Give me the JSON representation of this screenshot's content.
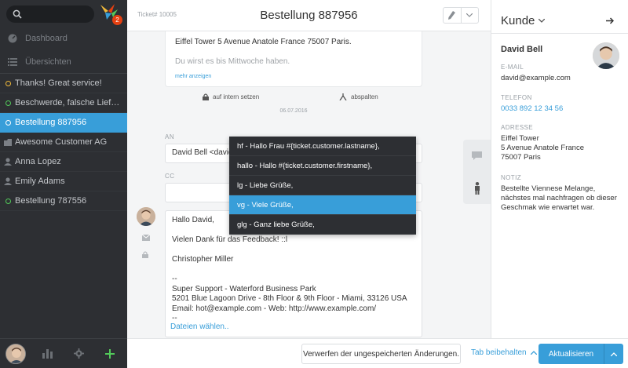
{
  "sidebar": {
    "search": {
      "placeholder": ""
    },
    "logo": {
      "badge": "2"
    },
    "main_nav": [
      {
        "label": "Dashboard",
        "icon": "dashboard-icon"
      },
      {
        "label": "Übersichten",
        "icon": "list-icon"
      }
    ],
    "items": [
      {
        "label": "Thanks! Great service!",
        "icon": "ticket-ring-icon",
        "color": "#f0b93a"
      },
      {
        "label": "Beschwerde, falsche Lieferung ...",
        "icon": "ticket-ring-icon",
        "color": "#52c95a"
      },
      {
        "label": "Bestellung 887956",
        "icon": "ticket-ring-icon",
        "color": "#ffffff",
        "active": true
      },
      {
        "label": "Awesome Customer AG",
        "icon": "organization-icon"
      },
      {
        "label": "Anna Lopez",
        "icon": "user-icon"
      },
      {
        "label": "Emily Adams",
        "icon": "user-icon"
      },
      {
        "label": "Bestellung 787556",
        "icon": "ticket-ring-icon",
        "color": "#52c95a"
      }
    ],
    "bottom": [
      "avatar",
      "stats-icon",
      "gear-icon",
      "plus-icon"
    ]
  },
  "header": {
    "ticket_number": "Ticket# 10005",
    "title": "Bestellung 887956"
  },
  "message": {
    "line1": "Eiffel Tower 5 Avenue Anatole France 75007 Paris.",
    "line2": "Du wirst es bis Mittwoche haben.",
    "more": "mehr anzeigen",
    "action_internal": "auf intern setzen",
    "action_split": "abspalten",
    "date": "06.07.2016"
  },
  "compose": {
    "to_label": "AN",
    "to_value": "David Bell <david@",
    "cc_label": "CC",
    "cc_value": "",
    "body_lines": [
      "Hallo David,",
      "",
      "Vielen Dank für das Feedback! ::l",
      "",
      "Christopher Miller",
      "",
      "--",
      "Super Support - Waterford Business Park",
      "5201 Blue Lagoon Drive - 8th Floor & 9th Floor - Miami, 33126 USA",
      "Email: hot@example.com - Web: http://www.example.com/",
      "--"
    ],
    "attach": "Dateien wählen.."
  },
  "dropdown": [
    {
      "label": "hf - Hallo Frau #{ticket.customer.lastname},"
    },
    {
      "label": "hallo - Hallo #{ticket.customer.firstname},"
    },
    {
      "label": "lg - Liebe Grüße,"
    },
    {
      "label": "vg - Viele Grüße,",
      "active": true
    },
    {
      "label": "glg - Ganz liebe Grüße,"
    }
  ],
  "bottom_bar": {
    "discard": "Verwerfen der ungespeicherten Änderungen.",
    "keep_tab": "Tab beibehalten",
    "update": "Aktualisieren"
  },
  "customer": {
    "title": "Kunde",
    "name": "David Bell",
    "email_label": "E-MAIL",
    "email": "david@example.com",
    "phone_label": "TELEFON",
    "phone": "0033 892 12 34 56",
    "address_label": "ADRESSE",
    "address_lines": [
      "Eiffel Tower",
      "5 Avenue Anatole France",
      "75007 Paris"
    ],
    "note_label": "NOTIZ",
    "note": "Bestellte Viennese Melange, nächstes mal nachfragen ob dieser Geschmak wie erwartet war."
  },
  "colors": {
    "accent": "#389ed9",
    "sidebar_bg": "#2d2f33",
    "badge": "#e54011"
  }
}
